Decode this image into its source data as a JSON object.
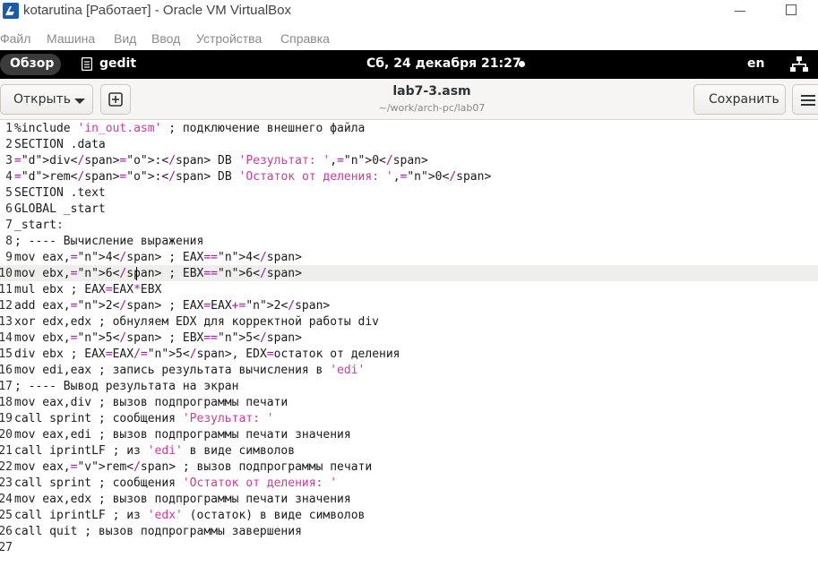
{
  "window": {
    "title": "kotarutina [Работает] - Oracle VM VirtualBox"
  },
  "vbox_menu": [
    "Файл",
    "Машина",
    "Вид",
    "Ввод",
    "Устройства",
    "Справка"
  ],
  "gnome_panel": {
    "overview": "Обзор",
    "app_name": "gedit",
    "clock": "Сб, 24 декабря  21:27",
    "language": "en"
  },
  "gedit": {
    "open_label": "Открыть",
    "save_label": "Сохранить",
    "doc_title": "lab7-3.asm",
    "doc_path": "~/work/arch-pc/lab07",
    "current_line": 10
  },
  "editor_lines": [
    {
      "n": "1",
      "text": "%include 'in_out.asm' ; подключение внешнего файла"
    },
    {
      "n": "2",
      "text": "SECTION .data"
    },
    {
      "n": "3",
      "text": "div: DB 'Результат: ',0"
    },
    {
      "n": "4",
      "text": "rem: DB 'Остаток от деления: ',0"
    },
    {
      "n": "5",
      "text": "SECTION .text"
    },
    {
      "n": "6",
      "text": "GLOBAL _start"
    },
    {
      "n": "7",
      "text": "_start:"
    },
    {
      "n": "8",
      "text": "; ---- Вычисление выражения"
    },
    {
      "n": "9",
      "text": "mov eax,4 ; EAX=4"
    },
    {
      "n": "10",
      "text": "mov ebx,6 ; EBX=6"
    },
    {
      "n": "11",
      "text": "mul ebx ; EAX=EAX*EBX"
    },
    {
      "n": "12",
      "text": "add eax,2 ; EAX=EAX+2"
    },
    {
      "n": "13",
      "text": "xor edx,edx ; обнуляем EDX для корректной работы div"
    },
    {
      "n": "14",
      "text": "mov ebx,5 ; EBX=5"
    },
    {
      "n": "15",
      "text": "div ebx ; EAX=EAX/5, EDX=остаток от деления"
    },
    {
      "n": "16",
      "text": "mov edi,eax ; запись результата вычисления в 'edi'"
    },
    {
      "n": "17",
      "text": "; ---- Вывод результата на экран"
    },
    {
      "n": "18",
      "text": "mov eax,div ; вызов подпрограммы печати"
    },
    {
      "n": "19",
      "text": "call sprint ; сообщения 'Результат: '"
    },
    {
      "n": "20",
      "text": "mov eax,edi ; вызов подпрограммы печати значения"
    },
    {
      "n": "21",
      "text": "call iprintLF ; из 'edi' в виде символов"
    },
    {
      "n": "22",
      "text": "mov eax,rem ; вызов подпрограммы печати"
    },
    {
      "n": "23",
      "text": "call sprint ; сообщения 'Остаток от деления: '"
    },
    {
      "n": "24",
      "text": "mov eax,edx ; вызов подпрограммы печати значения"
    },
    {
      "n": "25",
      "text": "call iprintLF ; из 'edx' (остаток) в виде символов"
    },
    {
      "n": "26",
      "text": "call quit ; вызов подпрограммы завершения"
    },
    {
      "n": "27",
      "text": ""
    }
  ]
}
